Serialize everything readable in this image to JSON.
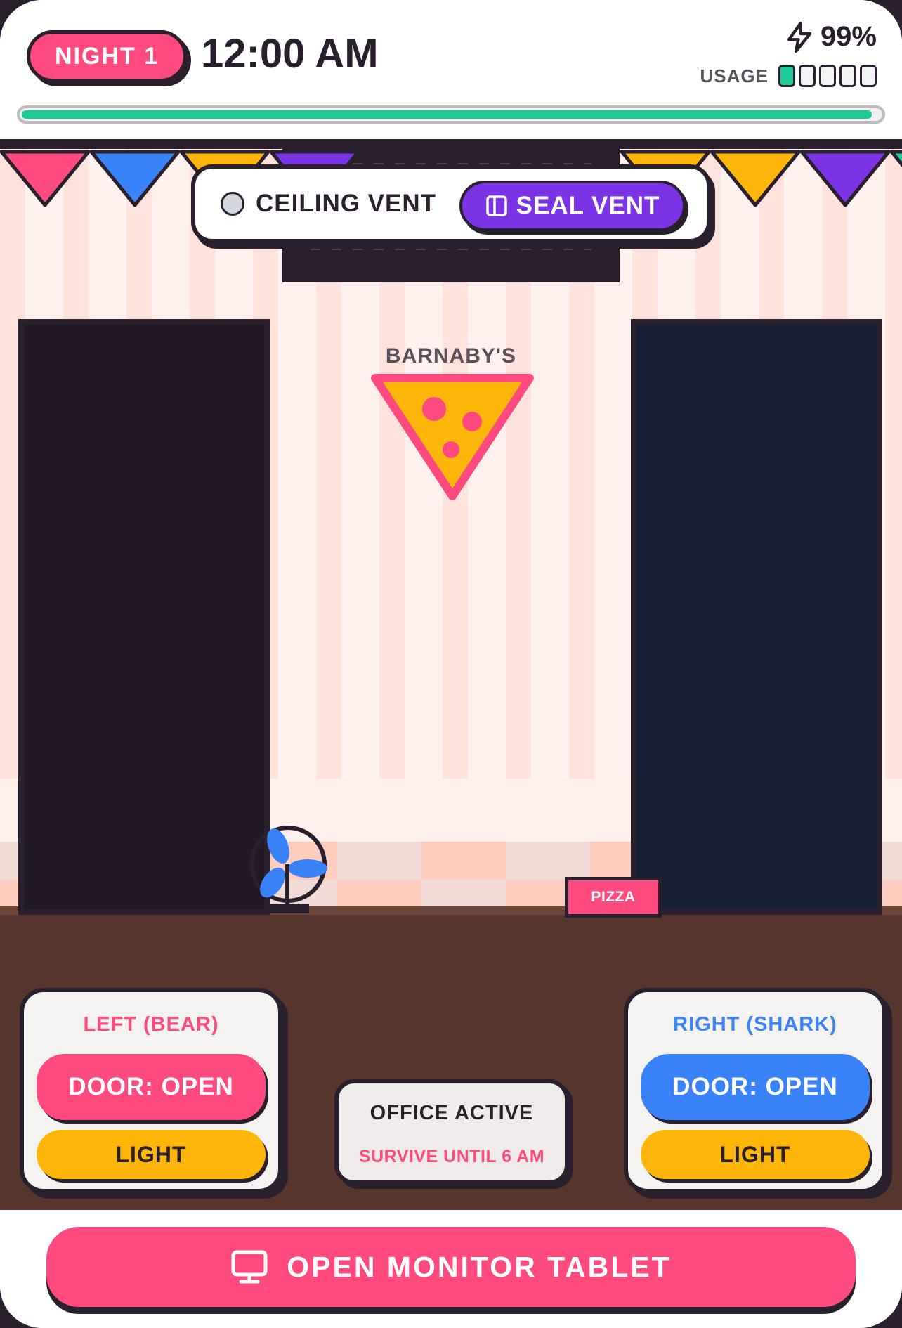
{
  "header": {
    "night_label": "NIGHT 1",
    "clock": "12:00 AM",
    "power_percent": "99%",
    "usage_label": "USAGE",
    "usage_level": 1,
    "usage_max": 5,
    "night_progress": 0.99
  },
  "vent": {
    "label": "CEILING VENT",
    "status": "open",
    "seal_button": "SEAL VENT",
    "seal_icon": "panel-icon"
  },
  "office": {
    "sign_title": "BARNABY'S",
    "pizza_box_label": "PIZZA",
    "bunting_colors": [
      "#ff4a80",
      "#3a82f7",
      "#ffb60a",
      "#7b33e6",
      "#ffb60a",
      "#7b33e6",
      "#1ec99a"
    ]
  },
  "left_panel": {
    "title": "LEFT (BEAR)",
    "door_button": "DOOR: OPEN",
    "light_button": "LIGHT"
  },
  "right_panel": {
    "title": "RIGHT (SHARK)",
    "door_button": "DOOR: OPEN",
    "light_button": "LIGHT"
  },
  "status": {
    "title": "OFFICE ACTIVE",
    "subtitle": "SURVIVE UNTIL 6 AM"
  },
  "bottom": {
    "monitor_button": "OPEN MONITOR TABLET",
    "monitor_icon": "monitor-icon"
  },
  "colors": {
    "accent_pink": "#ff4a80",
    "accent_blue": "#3a82f7",
    "accent_purple": "#7b33e6",
    "accent_yellow": "#ffb60a",
    "accent_green": "#1ec99a",
    "dark": "#2a1f2d"
  }
}
